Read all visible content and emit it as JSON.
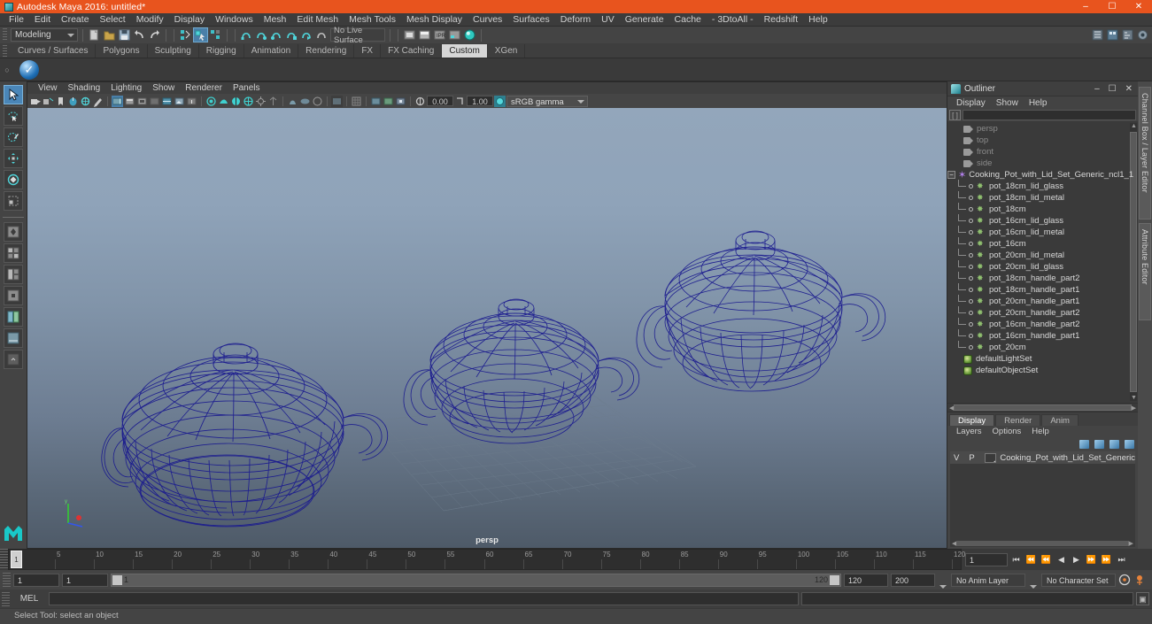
{
  "window": {
    "title": "Autodesk Maya 2016: untitled*",
    "app_icon": "maya-icon",
    "minimize": "–",
    "maximize": "☐",
    "close": "✕"
  },
  "menubar": {
    "items": [
      "File",
      "Edit",
      "Create",
      "Select",
      "Modify",
      "Display",
      "Windows",
      "Mesh",
      "Edit Mesh",
      "Mesh Tools",
      "Mesh Display",
      "Curves",
      "Surfaces",
      "Deform",
      "UV",
      "Generate",
      "Cache",
      "- 3DtoAll -",
      "Redshift",
      "Help"
    ]
  },
  "statusbar": {
    "menuset": "Modeling",
    "live_surface": "No Live Surface",
    "icons": [
      "new-scene-icon",
      "open-scene-icon",
      "save-scene-icon",
      "undo-icon",
      "redo-icon",
      "select-by-hierarchy-icon",
      "select-by-object-icon",
      "select-by-component-icon",
      "snap-to-grid-icon",
      "snap-to-curve-icon",
      "snap-to-point-icon",
      "snap-to-projected-center-icon",
      "snap-to-view-plane-icon",
      "make-live-icon",
      "render-view-icon",
      "render-current-frame-icon",
      "ipr-render-icon",
      "render-settings-icon",
      "hypershade-icon",
      "channel-box-toggle-icon",
      "layer-editor-toggle-icon",
      "attribute-editor-toggle-icon",
      "tool-settings-icon"
    ]
  },
  "shelf": {
    "tabs": [
      "Curves / Surfaces",
      "Polygons",
      "Sculpting",
      "Rigging",
      "Animation",
      "Rendering",
      "FX",
      "FX Caching",
      "Custom",
      "XGen"
    ],
    "active_tab": "Custom",
    "buttons": [
      "check-mark-icon"
    ]
  },
  "toolbox": {
    "tools": [
      "select-tool",
      "lasso-select-tool",
      "paint-select-tool",
      "move-tool",
      "rotate-tool",
      "scale-tool"
    ],
    "active_tool": "select-tool",
    "layouts": [
      "single-perspective-layout",
      "four-view-layout",
      "three-view-split-layout",
      "two-pane-stacked-layout",
      "outliner-persp-layout",
      "hypershade-persp-layout",
      "persp-graph-editor-layout"
    ],
    "logo": "maya-logo"
  },
  "viewport": {
    "menus": [
      "View",
      "Shading",
      "Lighting",
      "Show",
      "Renderer",
      "Panels"
    ],
    "toolbar_icons": [
      "select-camera-icon",
      "camera-attributes-icon",
      "bookmark-icon",
      "image-plane-icon",
      "two-d-pan-zoom-icon",
      "grease-pencil-icon",
      "wireframe-shading-icon",
      "smooth-shade-all-icon",
      "smooth-shade-selected-icon",
      "flat-shade-icon",
      "wireframe-on-shaded-icon",
      "texture-icon",
      "use-default-lighting-icon",
      "shadows-icon",
      "ambient-occlusion-icon",
      "motion-blur-icon",
      "multisample-icon",
      "depth-of-field-icon",
      "isolate-select-icon",
      "xray-icon",
      "xray-joints-icon",
      "xray-active-components-icon",
      "exposure-icon",
      "gamma-icon"
    ],
    "exposure_value": "0.00",
    "gamma_value": "1.00",
    "color_space": "sRGB gamma",
    "camera_label": "persp",
    "scene_description": "Three dark-blue wireframe cooking pots with lids on a grey-blue gradient background, sized 16cm, 18cm and 20cm",
    "axis_labels": {
      "y": "y",
      "x": "x",
      "z": "z"
    }
  },
  "outliner": {
    "title": "Outliner",
    "window_buttons": {
      "minimize": "–",
      "maximize": "☐",
      "close": "✕"
    },
    "menus": [
      "Display",
      "Show",
      "Help"
    ],
    "search_placeholder": "",
    "search_value": "",
    "items": [
      {
        "label": "persp",
        "icon": "camera-icon",
        "kind": "camera",
        "indent": 1,
        "dim": true
      },
      {
        "label": "top",
        "icon": "camera-icon",
        "kind": "camera",
        "indent": 1,
        "dim": true
      },
      {
        "label": "front",
        "icon": "camera-icon",
        "kind": "camera",
        "indent": 1,
        "dim": true
      },
      {
        "label": "side",
        "icon": "camera-icon",
        "kind": "camera",
        "indent": 1,
        "dim": true
      },
      {
        "label": "Cooking_Pot_with_Lid_Set_Generic_ncl1_1",
        "icon": "group-star-icon",
        "kind": "group",
        "indent": 0,
        "dim": false,
        "expanded": true
      },
      {
        "label": "pot_18cm_lid_glass",
        "icon": "mesh-icon",
        "kind": "mesh",
        "indent": 2,
        "dim": false
      },
      {
        "label": "pot_18cm_lid_metal",
        "icon": "mesh-icon",
        "kind": "mesh",
        "indent": 2,
        "dim": false
      },
      {
        "label": "pot_18cm",
        "icon": "mesh-icon",
        "kind": "mesh",
        "indent": 2,
        "dim": false
      },
      {
        "label": "pot_16cm_lid_glass",
        "icon": "mesh-icon",
        "kind": "mesh",
        "indent": 2,
        "dim": false
      },
      {
        "label": "pot_16cm_lid_metal",
        "icon": "mesh-icon",
        "kind": "mesh",
        "indent": 2,
        "dim": false
      },
      {
        "label": "pot_16cm",
        "icon": "mesh-icon",
        "kind": "mesh",
        "indent": 2,
        "dim": false
      },
      {
        "label": "pot_20cm_lid_metal",
        "icon": "mesh-icon",
        "kind": "mesh",
        "indent": 2,
        "dim": false
      },
      {
        "label": "pot_20cm_lid_glass",
        "icon": "mesh-icon",
        "kind": "mesh",
        "indent": 2,
        "dim": false
      },
      {
        "label": "pot_18cm_handle_part2",
        "icon": "mesh-icon",
        "kind": "mesh",
        "indent": 2,
        "dim": false
      },
      {
        "label": "pot_18cm_handle_part1",
        "icon": "mesh-icon",
        "kind": "mesh",
        "indent": 2,
        "dim": false
      },
      {
        "label": "pot_20cm_handle_part1",
        "icon": "mesh-icon",
        "kind": "mesh",
        "indent": 2,
        "dim": false
      },
      {
        "label": "pot_20cm_handle_part2",
        "icon": "mesh-icon",
        "kind": "mesh",
        "indent": 2,
        "dim": false
      },
      {
        "label": "pot_16cm_handle_part2",
        "icon": "mesh-icon",
        "kind": "mesh",
        "indent": 2,
        "dim": false
      },
      {
        "label": "pot_16cm_handle_part1",
        "icon": "mesh-icon",
        "kind": "mesh",
        "indent": 2,
        "dim": false
      },
      {
        "label": "pot_20cm",
        "icon": "mesh-icon",
        "kind": "mesh",
        "indent": 2,
        "dim": false
      },
      {
        "label": "defaultLightSet",
        "icon": "set-icon",
        "kind": "set",
        "indent": 1,
        "dim": false
      },
      {
        "label": "defaultObjectSet",
        "icon": "set-icon",
        "kind": "set",
        "indent": 1,
        "dim": false
      }
    ]
  },
  "layer_editor": {
    "tabs": [
      "Display",
      "Render",
      "Anim"
    ],
    "active_tab": "Display",
    "menus": [
      "Layers",
      "Options",
      "Help"
    ],
    "buttons": [
      "layer-prev-icon",
      "layer-prev-all-icon",
      "layer-next-icon",
      "layer-next-all-icon"
    ],
    "columns": [
      "V",
      "P"
    ],
    "layers": [
      {
        "visible": "",
        "playback": "",
        "name": "Cooking_Pot_with_Lid_Set_Generic"
      }
    ]
  },
  "sidebar_tabs": [
    "Channel Box / Layer Editor",
    "Attribute Editor"
  ],
  "timeline": {
    "ticks": [
      5,
      10,
      15,
      20,
      25,
      30,
      35,
      40,
      45,
      50,
      55,
      60,
      65,
      70,
      75,
      80,
      85,
      90,
      95,
      100,
      105,
      110,
      115,
      120
    ],
    "start": 1,
    "end": 120,
    "current_frame": "1",
    "current_frame_field": "1",
    "transport": [
      "go-to-start-icon",
      "step-back-keyframe-icon",
      "step-back-frame-icon",
      "play-backwards-icon",
      "play-forwards-icon",
      "step-forward-frame-icon",
      "step-forward-keyframe-icon",
      "go-to-end-icon"
    ]
  },
  "range": {
    "anim_start": "1",
    "range_start": "1",
    "slider_start_value": "1",
    "slider_end_value": "120",
    "range_end": "120",
    "anim_end": "200",
    "anim_layer": "No Anim Layer",
    "character_set": "No Character Set",
    "auto_key_icon": "auto-keyframe-icon",
    "anim_prefs_icon": "animation-preferences-icon"
  },
  "command_line": {
    "label": "MEL",
    "input_value": "",
    "output_value": "",
    "script_editor_icon": "script-editor-icon"
  },
  "help_line": {
    "text": "Select Tool: select an object"
  },
  "colors": {
    "title_bar": "#e8541e",
    "wireframe": "#1c1c8e",
    "accent_blue": "#4a86b8",
    "panel_bg": "#444444",
    "list_bg": "#3a3a3a"
  }
}
